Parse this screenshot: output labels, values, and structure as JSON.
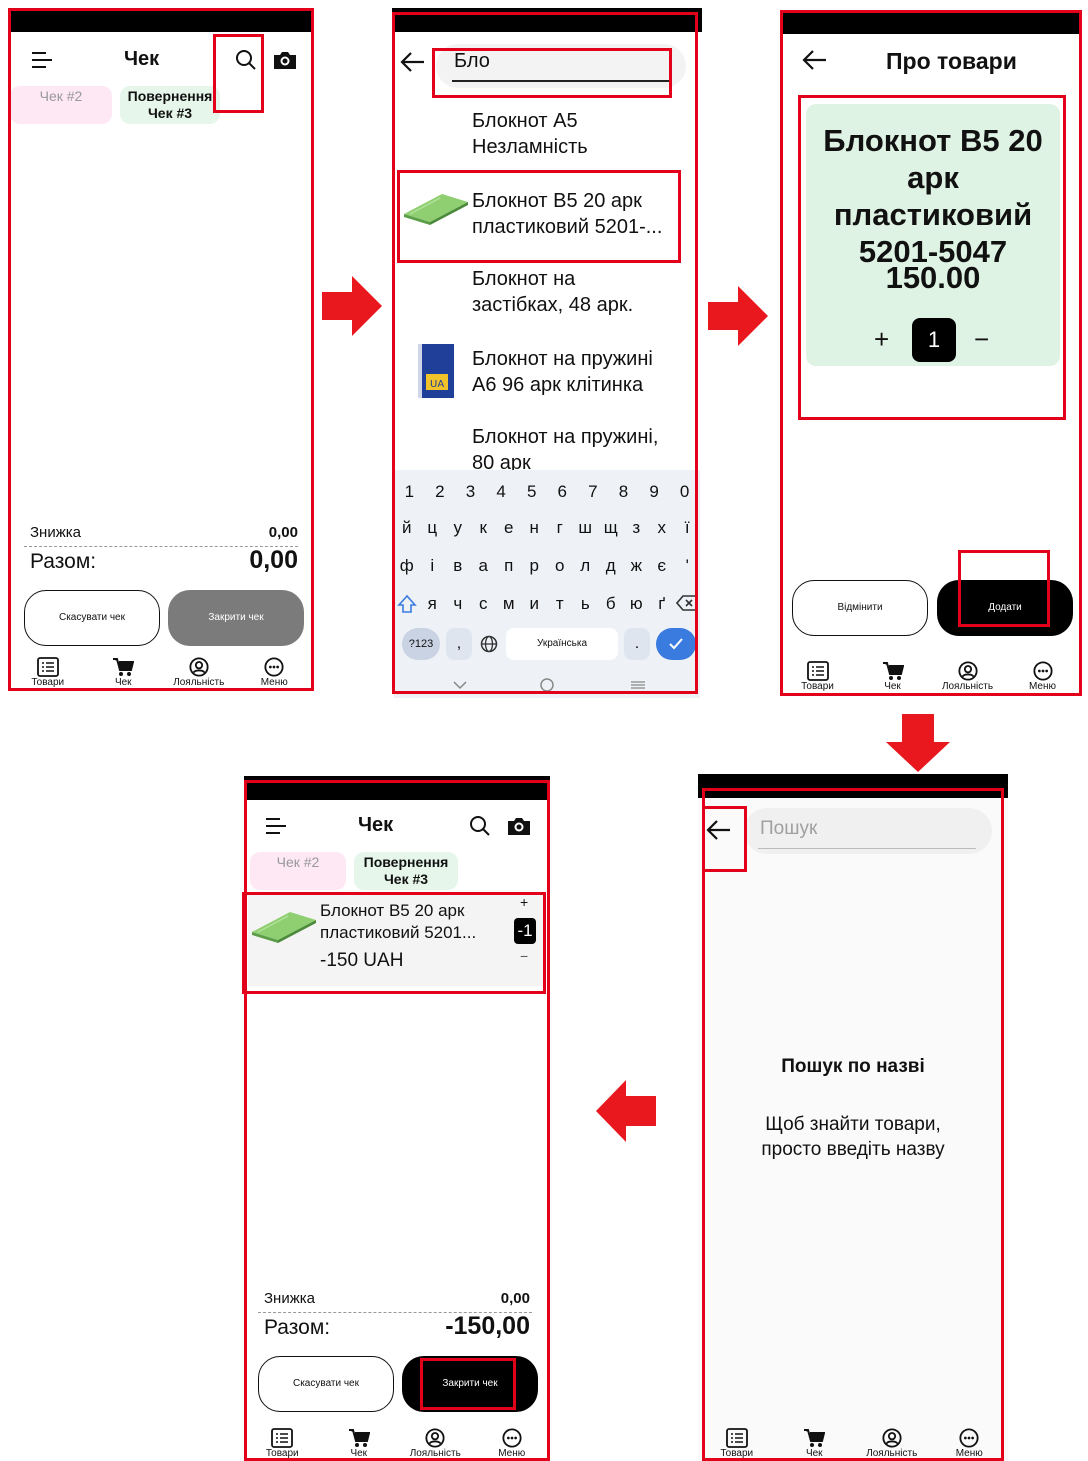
{
  "check_screen": {
    "title": "Чек",
    "tabs": [
      "Чек #2",
      "Повернення",
      "Чек #3"
    ],
    "discount_label": "Знижка",
    "discount_value": "0,00",
    "total_label": "Разом:",
    "total_value": "0,00",
    "cancel_button": "Скасувати чек",
    "close_button": "Закрити чек"
  },
  "nav": {
    "products": "Товари",
    "check": "Чек",
    "loyalty": "Лояльність",
    "menu": "Меню"
  },
  "search_screen": {
    "query": "Бло",
    "results": [
      {
        "line1": "Блокнот А5",
        "line2": "Незламність"
      },
      {
        "line1": "Блокнот В5 20 арк",
        "line2": "пластиковий 5201-..."
      },
      {
        "line1": "Блокнот на",
        "line2": "застібках, 48 арк."
      },
      {
        "line1": "Блокнот на пружині",
        "line2": "А6 96 арк клітинка"
      },
      {
        "line1": "Блокнот на пружині,",
        "line2": "80 арк"
      }
    ],
    "keyboard": {
      "row1": [
        "1",
        "2",
        "3",
        "4",
        "5",
        "6",
        "7",
        "8",
        "9",
        "0"
      ],
      "row2": [
        "й",
        "ц",
        "у",
        "к",
        "е",
        "н",
        "г",
        "ш",
        "щ",
        "з",
        "х",
        "ї"
      ],
      "row3": [
        "ф",
        "і",
        "в",
        "а",
        "п",
        "р",
        "о",
        "л",
        "д",
        "ж",
        "є",
        "'"
      ],
      "row4": [
        "я",
        "ч",
        "с",
        "м",
        "и",
        "т",
        "ь",
        "б",
        "ю",
        "ґ"
      ],
      "sym_key": "?123",
      "comma_key": ",",
      "space_label": "Українська",
      "dot_key": "."
    }
  },
  "product_screen": {
    "title": "Про товари",
    "product_name": [
      "Блокнот В5 20",
      "арк пластиковий",
      "5201-5047"
    ],
    "price": "150.00",
    "plus": "+",
    "quantity": "1",
    "minus": "−",
    "cancel_button": "Відмінити",
    "add_button": "Додати"
  },
  "empty_search_screen": {
    "placeholder": "Пошук",
    "heading": "Пошук по назві",
    "hint_line1": "Щоб знайти товари,",
    "hint_line2": "просто введіть назву"
  },
  "check_result_screen": {
    "title": "Чек",
    "tabs": [
      "Чек #2",
      "Повернення",
      "Чек #3"
    ],
    "item_name_line1": "Блокнот В5 20 арк",
    "item_name_line2": "пластиковий 5201...",
    "item_price": "-150 UAH",
    "item_qty": "-1",
    "item_plus": "+",
    "item_minus": "−",
    "discount_label": "Знижка",
    "discount_value": "0,00",
    "total_label": "Разом:",
    "total_value": "-150,00",
    "cancel_button": "Скасувати чек",
    "close_button": "Закрити чек"
  },
  "colors": {
    "highlight": "#e2001a",
    "arrow": "#e8181e",
    "product_card": "#dff3e4",
    "accent_blue": "#3a7be0"
  }
}
